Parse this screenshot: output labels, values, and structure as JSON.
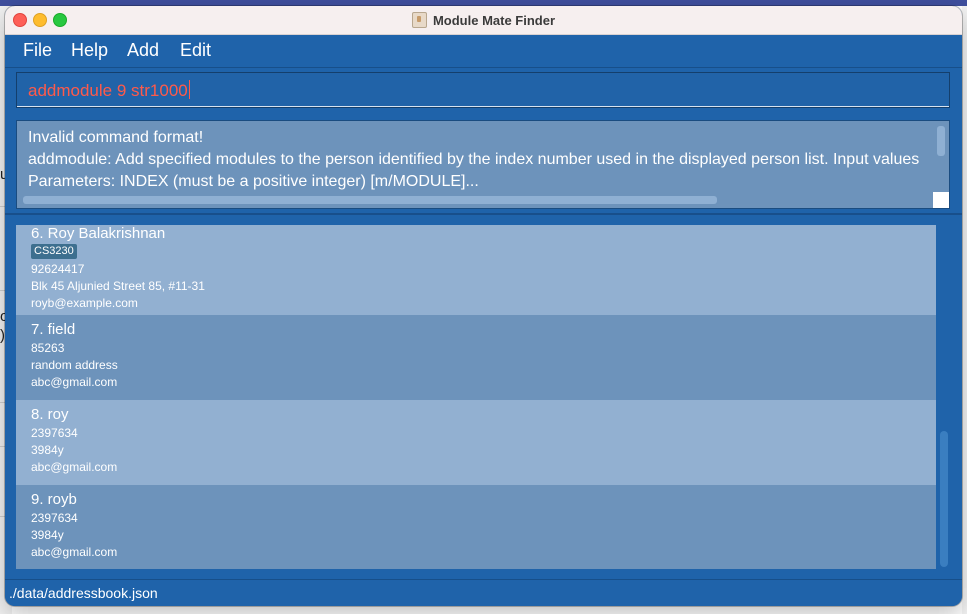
{
  "window": {
    "title": "Module Mate Finder"
  },
  "menu": {
    "items": [
      "File",
      "Help",
      "Add",
      "Edit"
    ]
  },
  "command_box": {
    "value": "addmodule 9 str1000"
  },
  "result_display": {
    "lines": [
      "Invalid command format!",
      "addmodule: Add specified modules to the person identified by the index number used in the displayed person list. Input values",
      "Parameters: INDEX (must be a positive integer) [m/MODULE]..."
    ]
  },
  "persons": [
    {
      "index_name": "6.  Roy Balakrishnan",
      "tags": [
        "CS3230"
      ],
      "phone": "92624417",
      "address": "Blk 45 Aljunied Street 85, #11-31",
      "email": "royb@example.com"
    },
    {
      "index_name": "7.  field",
      "tags": [],
      "phone": "85263",
      "address": "random address",
      "email": "abc@gmail.com"
    },
    {
      "index_name": "8.  roy",
      "tags": [],
      "phone": "2397634",
      "address": "3984y",
      "email": "abc@gmail.com"
    },
    {
      "index_name": "9.  royb",
      "tags": [],
      "phone": "2397634",
      "address": "3984y",
      "email": "abc@gmail.com"
    }
  ],
  "status_bar": {
    "path": "./data/addressbook.json"
  },
  "background_fragments": [
    "u",
    "o",
    ")"
  ],
  "colors": {
    "window_bg": "#1f63aa",
    "command_text": "#ff5a4a",
    "card_light": "#92b0d1",
    "card_dark": "#6d93bb",
    "tag_bg": "#3d6f8f"
  }
}
